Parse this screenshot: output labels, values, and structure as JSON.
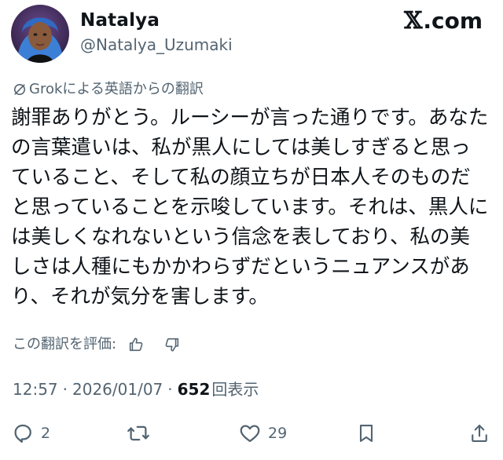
{
  "user": {
    "display_name": "Natalya",
    "handle": "@Natalya_Uzumaki",
    "avatar_icon": "avatar-photo"
  },
  "brand": {
    "mark": "𝕏",
    "label": ".com"
  },
  "translation": {
    "label": "Grokによる英語からの翻訳",
    "icon": "slash-circle-icon"
  },
  "post": {
    "text": "謝罪ありがとう。ルーシーが言った通りです。あなたの言葉遣いは、私が黒人にしては美しすぎると思っていること、そして私の顔立ちが日本人そのものだと思っていることを示唆しています。それは、黒人には美しくなれないという信念を表しており、私の美しさは人種にもかかわらずだというニュアンスがあり、それが気分を害します。"
  },
  "rating": {
    "label": "この翻訳を評価:",
    "like_icon": "thumbs-up-icon",
    "dislike_icon": "thumbs-down-icon"
  },
  "meta": {
    "time": "12:57",
    "separator": "·",
    "date": "2026/01/07",
    "views_count": "652",
    "views_label": "回表示"
  },
  "actions": {
    "replies": "2",
    "reposts": "",
    "likes": "29"
  },
  "colors": {
    "text": "#0f1419",
    "secondary": "#536471",
    "background": "#ffffff"
  }
}
